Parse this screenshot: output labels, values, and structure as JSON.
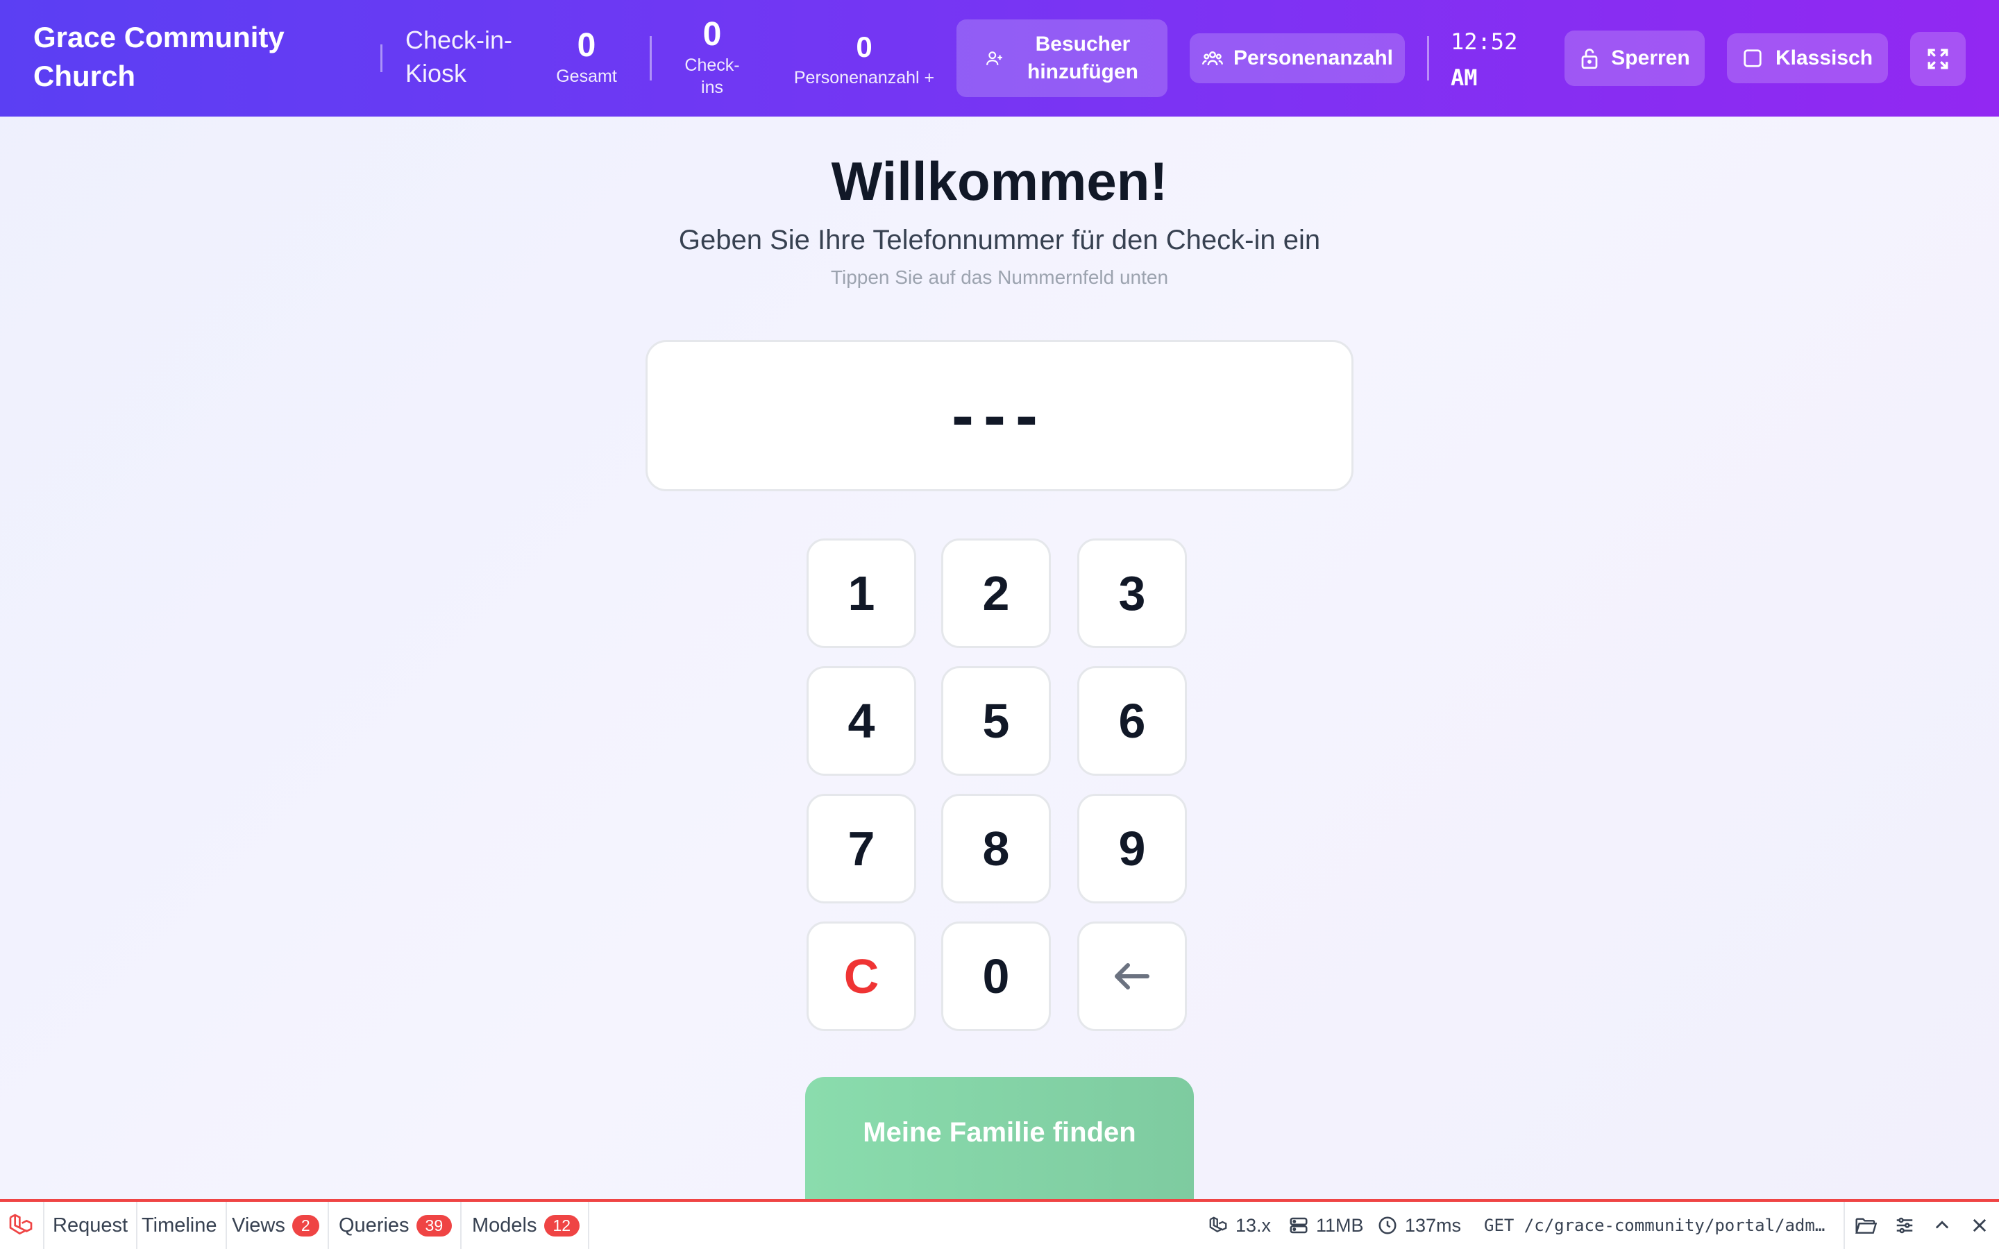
{
  "header": {
    "church_name": "Grace Community Church",
    "kiosk_label": "Check-in-Kiosk",
    "stats": [
      {
        "value": "0",
        "label": "Gesamt"
      },
      {
        "value": "0",
        "label": "Check-ins"
      },
      {
        "value": "0",
        "label": "Personenanzahl +"
      }
    ],
    "add_visitor_label": "Besucher hinzufügen",
    "headcount_label": "Personenanzahl",
    "clock_time": "12:52",
    "clock_period": "AM",
    "lock_label": "Sperren",
    "classic_label": "Klassisch"
  },
  "main": {
    "title": "Willkommen!",
    "subtitle": "Geben Sie Ihre Telefonnummer für den Check-in ein",
    "hint": "Tippen Sie auf das Nummernfeld unten",
    "display_value": "---",
    "keys": [
      "1",
      "2",
      "3",
      "4",
      "5",
      "6",
      "7",
      "8",
      "9",
      "C",
      "0"
    ],
    "find_family_label": "Meine Familie finden"
  },
  "debugbar": {
    "tabs": [
      {
        "label": "Request"
      },
      {
        "label": "Timeline"
      },
      {
        "label": "Views",
        "count": "2"
      },
      {
        "label": "Queries",
        "count": "39"
      },
      {
        "label": "Models",
        "count": "12"
      }
    ],
    "version": "13.x",
    "memory": "11MB",
    "duration": "137ms",
    "route": "GET /c/grace-community/portal/adm…"
  },
  "colors": {
    "header_start": "#5b3ff3",
    "header_end": "#9228f2",
    "clear_key": "#ef3434",
    "find_button": "#8adcad",
    "debug_accent": "#ef4444"
  }
}
